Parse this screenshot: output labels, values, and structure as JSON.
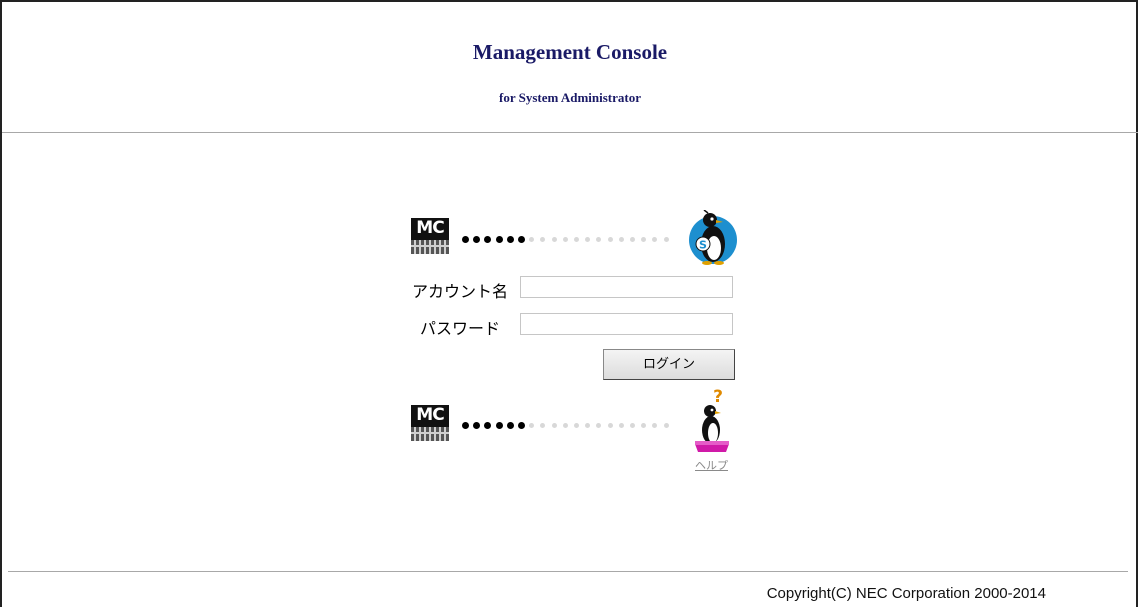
{
  "header": {
    "title": "Management Console",
    "subtitle": "for System Administrator"
  },
  "login_form": {
    "account_label": "アカウント名",
    "account_value": "",
    "password_label": "パスワード",
    "password_value": "",
    "login_button": "ログイン"
  },
  "logos": {
    "mc_icon_text": "MC",
    "server_badge_letter": "S",
    "progress_filled_dots": 6,
    "progress_total_dots": 19
  },
  "help": {
    "label": "ヘルプ"
  },
  "footer": {
    "copyright": "Copyright(C) NEC Corporation 2000-2014"
  },
  "colors": {
    "title": "#1a1a66",
    "badge_blue": "#1d8fcf",
    "help_magenta": "#d01aa8",
    "help_question": "#e08a00"
  }
}
